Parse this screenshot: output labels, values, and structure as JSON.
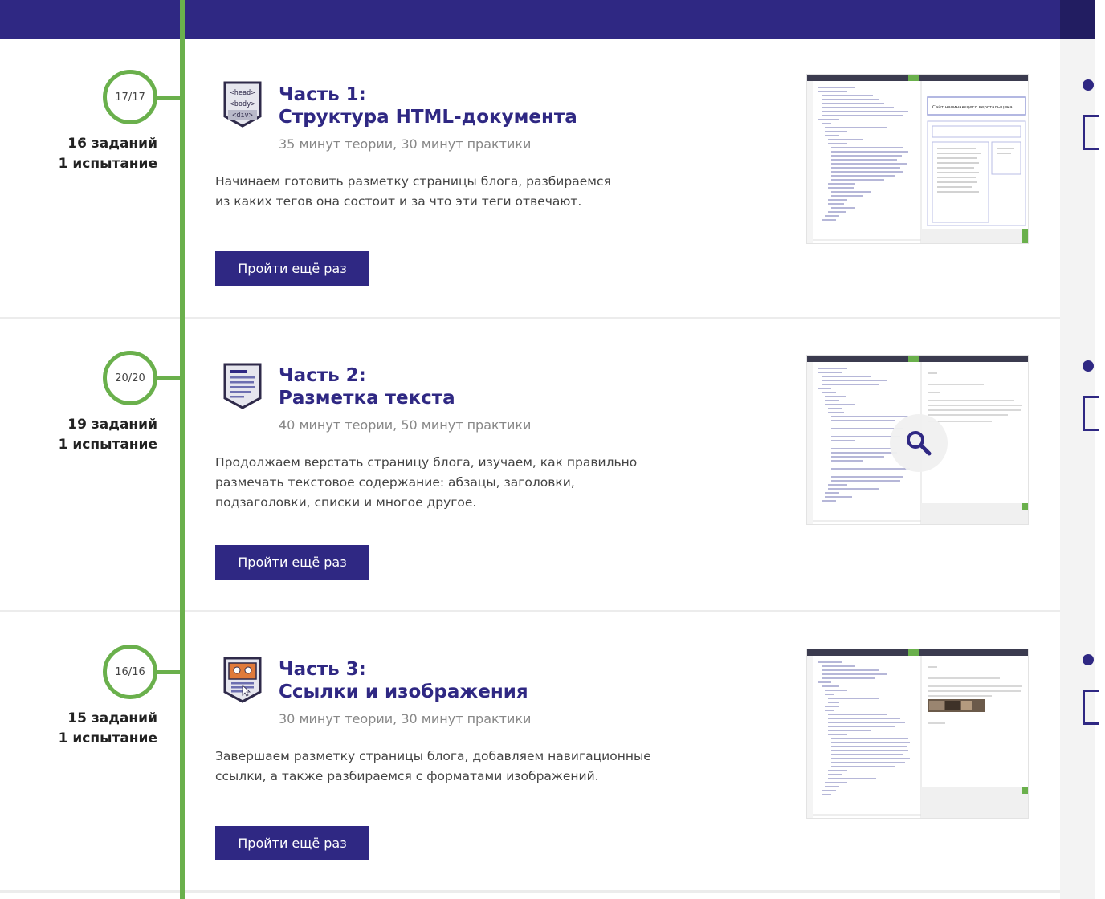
{
  "parts": [
    {
      "counter": "17/17",
      "tasks": "16 заданий",
      "tests": "1 испытание",
      "title_line1": "Часть 1:",
      "title_line2": "Структура HTML-документа",
      "duration": "35 минут теории, 30 минут практики",
      "desc_line1": "Начинаем готовить разметку страницы блога, разбираемся",
      "desc_line2": "из каких тегов она состоит и за что эти теги отвечают.",
      "desc_line3": "",
      "button": "Пройти ещё раз",
      "icon": "html-tags-icon",
      "icon_tags": [
        "<head>",
        "<body>",
        "<div>"
      ]
    },
    {
      "counter": "20/20",
      "tasks": "19 заданий",
      "tests": "1 испытание",
      "title_line1": "Часть 2:",
      "title_line2": "Разметка текста",
      "duration": "40 минут теории, 50 минут практики",
      "desc_line1": "Продолжаем верстать страницу блога, изучаем, как правильно",
      "desc_line2": "размечать текстовое содержание: абзацы, заголовки,",
      "desc_line3": "подзаголовки, списки и многое другое.",
      "button": "Пройти ещё раз",
      "icon": "text-document-icon"
    },
    {
      "counter": "16/16",
      "tasks": "15 заданий",
      "tests": "1 испытание",
      "title_line1": "Часть 3:",
      "title_line2": "Ссылки и изображения",
      "duration": "30 минут теории, 30 минут практики",
      "desc_line1": "Завершаем разметку страницы блога, добавляем навигационные",
      "desc_line2": "ссылки, а также разбираемся с форматами изображений.",
      "desc_line3": "",
      "button": "Пройти ещё раз",
      "icon": "image-document-icon"
    }
  ],
  "colors": {
    "brand": "#2f2883",
    "timeline": "#6ab04c",
    "muted": "#888888"
  },
  "preview": {
    "zoom_icon": "magnifier-icon",
    "shot1_title": "Сайт начинающего верстальщика"
  }
}
